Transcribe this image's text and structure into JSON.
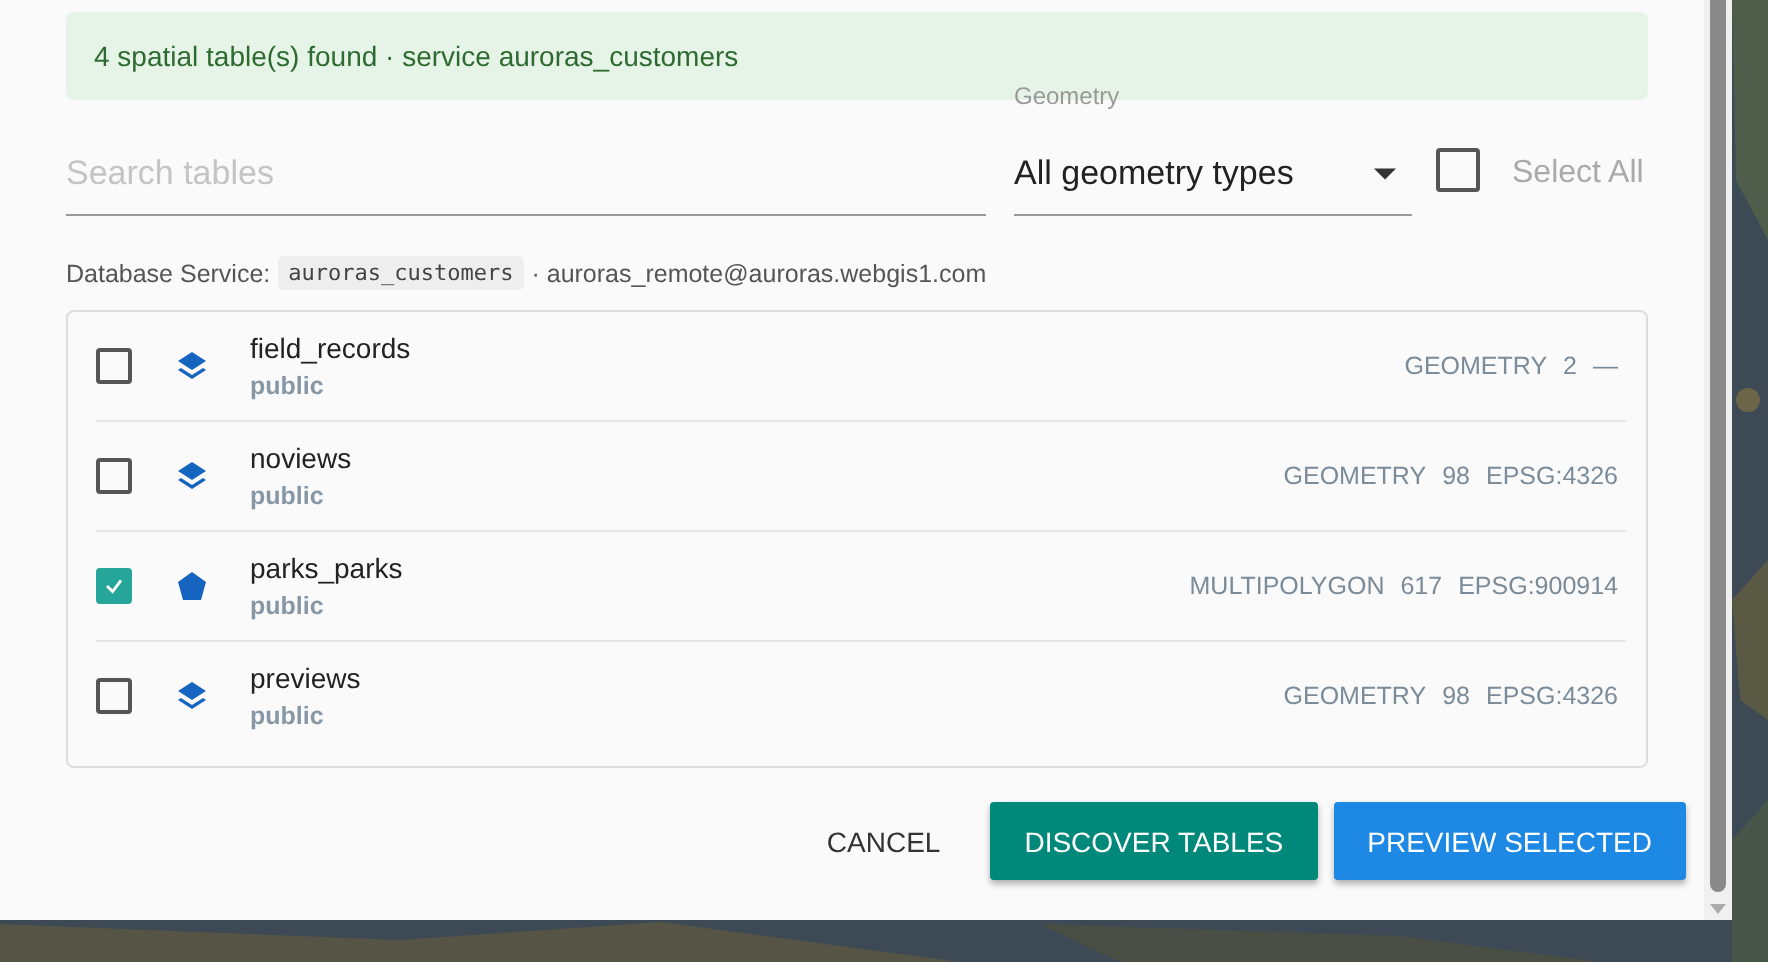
{
  "alert": "4 spatial table(s) found · service auroras_customers",
  "search": {
    "placeholder": "Search tables"
  },
  "geometry_filter": {
    "label": "Geometry",
    "value": "All geometry types"
  },
  "select_all": {
    "label": "Select All",
    "checked": false
  },
  "service_info": {
    "label": "Database Service:",
    "service": "auroras_customers",
    "connection": "· auroras_remote@auroras.webgis1.com"
  },
  "tables": [
    {
      "name": "field_records",
      "schema": "public",
      "kind": "layers",
      "checked": false,
      "meta": [
        "GEOMETRY",
        "2",
        "—"
      ]
    },
    {
      "name": "noviews",
      "schema": "public",
      "kind": "layers",
      "checked": false,
      "meta": [
        "GEOMETRY",
        "98",
        "EPSG:4326"
      ]
    },
    {
      "name": "parks_parks",
      "schema": "public",
      "kind": "polygon",
      "checked": true,
      "meta": [
        "MULTIPOLYGON",
        "617",
        "EPSG:900914"
      ]
    },
    {
      "name": "previews",
      "schema": "public",
      "kind": "layers",
      "checked": false,
      "meta": [
        "GEOMETRY",
        "98",
        "EPSG:4326"
      ]
    }
  ],
  "buttons": [
    {
      "label": "CANCEL",
      "kind": "text"
    },
    {
      "label": "DISCOVER TABLES",
      "kind": "teal"
    },
    {
      "label": "PREVIEW SELECTED",
      "kind": "blue"
    }
  ]
}
